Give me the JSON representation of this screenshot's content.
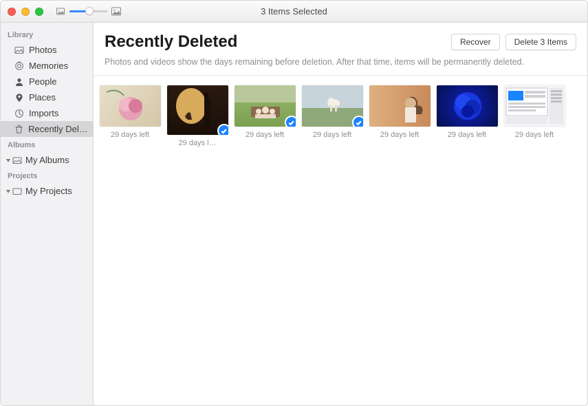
{
  "window": {
    "title": "3 Items Selected"
  },
  "sidebar": {
    "section_library": "Library",
    "library": [
      {
        "label": "Photos",
        "icon": "photos"
      },
      {
        "label": "Memories",
        "icon": "memories"
      },
      {
        "label": "People",
        "icon": "people"
      },
      {
        "label": "Places",
        "icon": "places"
      },
      {
        "label": "Imports",
        "icon": "imports"
      },
      {
        "label": "Recently Dele…",
        "icon": "trash",
        "selected": true
      }
    ],
    "section_albums": "Albums",
    "albums_item": "My Albums",
    "section_projects": "Projects",
    "projects_item": "My Projects"
  },
  "header": {
    "title": "Recently Deleted",
    "recover_btn": "Recover",
    "delete_btn": "Delete 3 Items"
  },
  "subtext": "Photos and videos show the days remaining before deletion. After that time, items will be permanently deleted.",
  "items": [
    {
      "caption": "29 days left",
      "selected": false
    },
    {
      "caption": "29 days l…",
      "selected": true,
      "tall": true
    },
    {
      "caption": "29 days left",
      "selected": true
    },
    {
      "caption": "29 days left",
      "selected": true
    },
    {
      "caption": "29 days left",
      "selected": false
    },
    {
      "caption": "29 days left",
      "selected": false
    },
    {
      "caption": "29 days left",
      "selected": false
    }
  ]
}
